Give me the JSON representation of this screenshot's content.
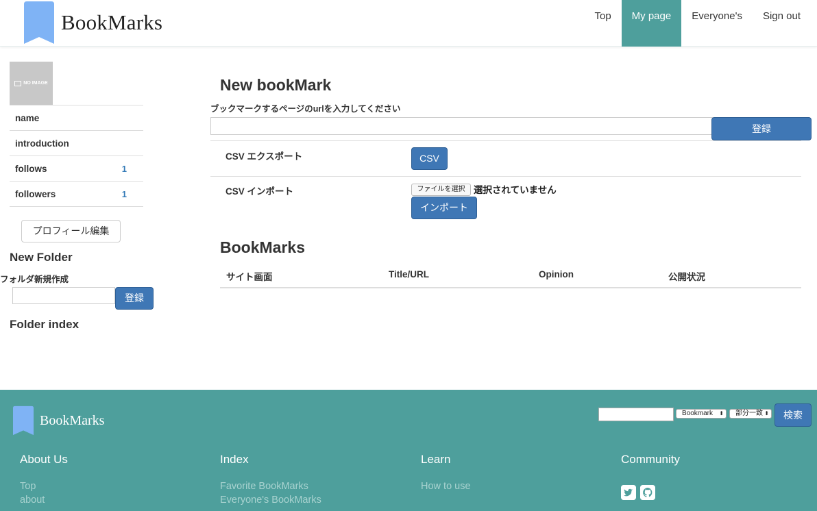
{
  "header": {
    "brand": "BookMarks",
    "nav": [
      {
        "label": "Top"
      },
      {
        "label": "My page",
        "active": true
      },
      {
        "label": "Everyone's"
      },
      {
        "label": "Sign out"
      }
    ]
  },
  "sidebar": {
    "avatar_text": "NO IMAGE",
    "profile": {
      "name_label": "name",
      "introduction_label": "introduction",
      "follows_label": "follows",
      "follows_count": "1",
      "followers_label": "followers",
      "followers_count": "1"
    },
    "edit_profile_button": "プロフィール編集",
    "new_folder_heading": "New Folder",
    "new_folder_label": "フォルダ新規作成",
    "new_folder_value": "",
    "new_folder_submit": "登録",
    "folder_index_heading": "Folder index"
  },
  "main": {
    "new_bookmark_heading": "New bookMark",
    "url_label": "ブックマークするページのurlを入力してください",
    "url_value": "",
    "register_button": "登録",
    "csv_export_label": "CSV エクスポート",
    "csv_button": "CSV",
    "csv_import_label": "CSV インポート",
    "file_button": "ファイルを選択",
    "file_status": "選択されていません",
    "import_button": "インポート",
    "bookmarks_heading": "BookMarks",
    "table_columns": [
      "サイト画面",
      "Title/URL",
      "Opinion",
      "公開状況"
    ]
  },
  "footer": {
    "brand": "BookMarks",
    "search": {
      "value": "",
      "type_select": "Bookmark",
      "match_select": "部分一致",
      "button": "検索"
    },
    "columns": [
      {
        "heading": "About Us",
        "links": [
          "Top",
          "about"
        ]
      },
      {
        "heading": "Index",
        "links": [
          "Favorite BookMarks",
          "Everyone's BookMarks"
        ]
      },
      {
        "heading": "Learn",
        "links": [
          "How to use"
        ]
      },
      {
        "heading": "Community",
        "links": []
      }
    ],
    "social_icons": [
      "twitter-icon",
      "github-icon"
    ]
  },
  "colors": {
    "teal": "#4e9f9c",
    "primary_button": "#3f77b5",
    "logo_blue": "#7fb3f5",
    "footer_link": "#a9d3d0"
  }
}
